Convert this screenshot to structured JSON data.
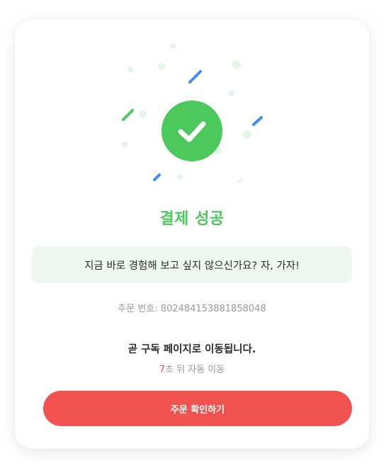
{
  "title": "결제 성공",
  "banner_text": "지금 바로 경험해 보고 싶지 않으신가요? 자, 가자!",
  "order": {
    "label": "주문 번호:",
    "number": "802484153881858048"
  },
  "redirect_message": "곧 구독 페이지로 이동됩니다.",
  "countdown": {
    "seconds": "7",
    "suffix": "초 뒤 자동 이동"
  },
  "confirm_button_label": "주문 확인하기",
  "colors": {
    "success_green": "#4cc95c",
    "banner_bg": "#eef8ef",
    "accent_red": "#f0524f",
    "confetti_blue": "#3d8ef5",
    "muted_text": "#9a9a9a"
  },
  "icons": {
    "success": "check-circle-icon"
  }
}
